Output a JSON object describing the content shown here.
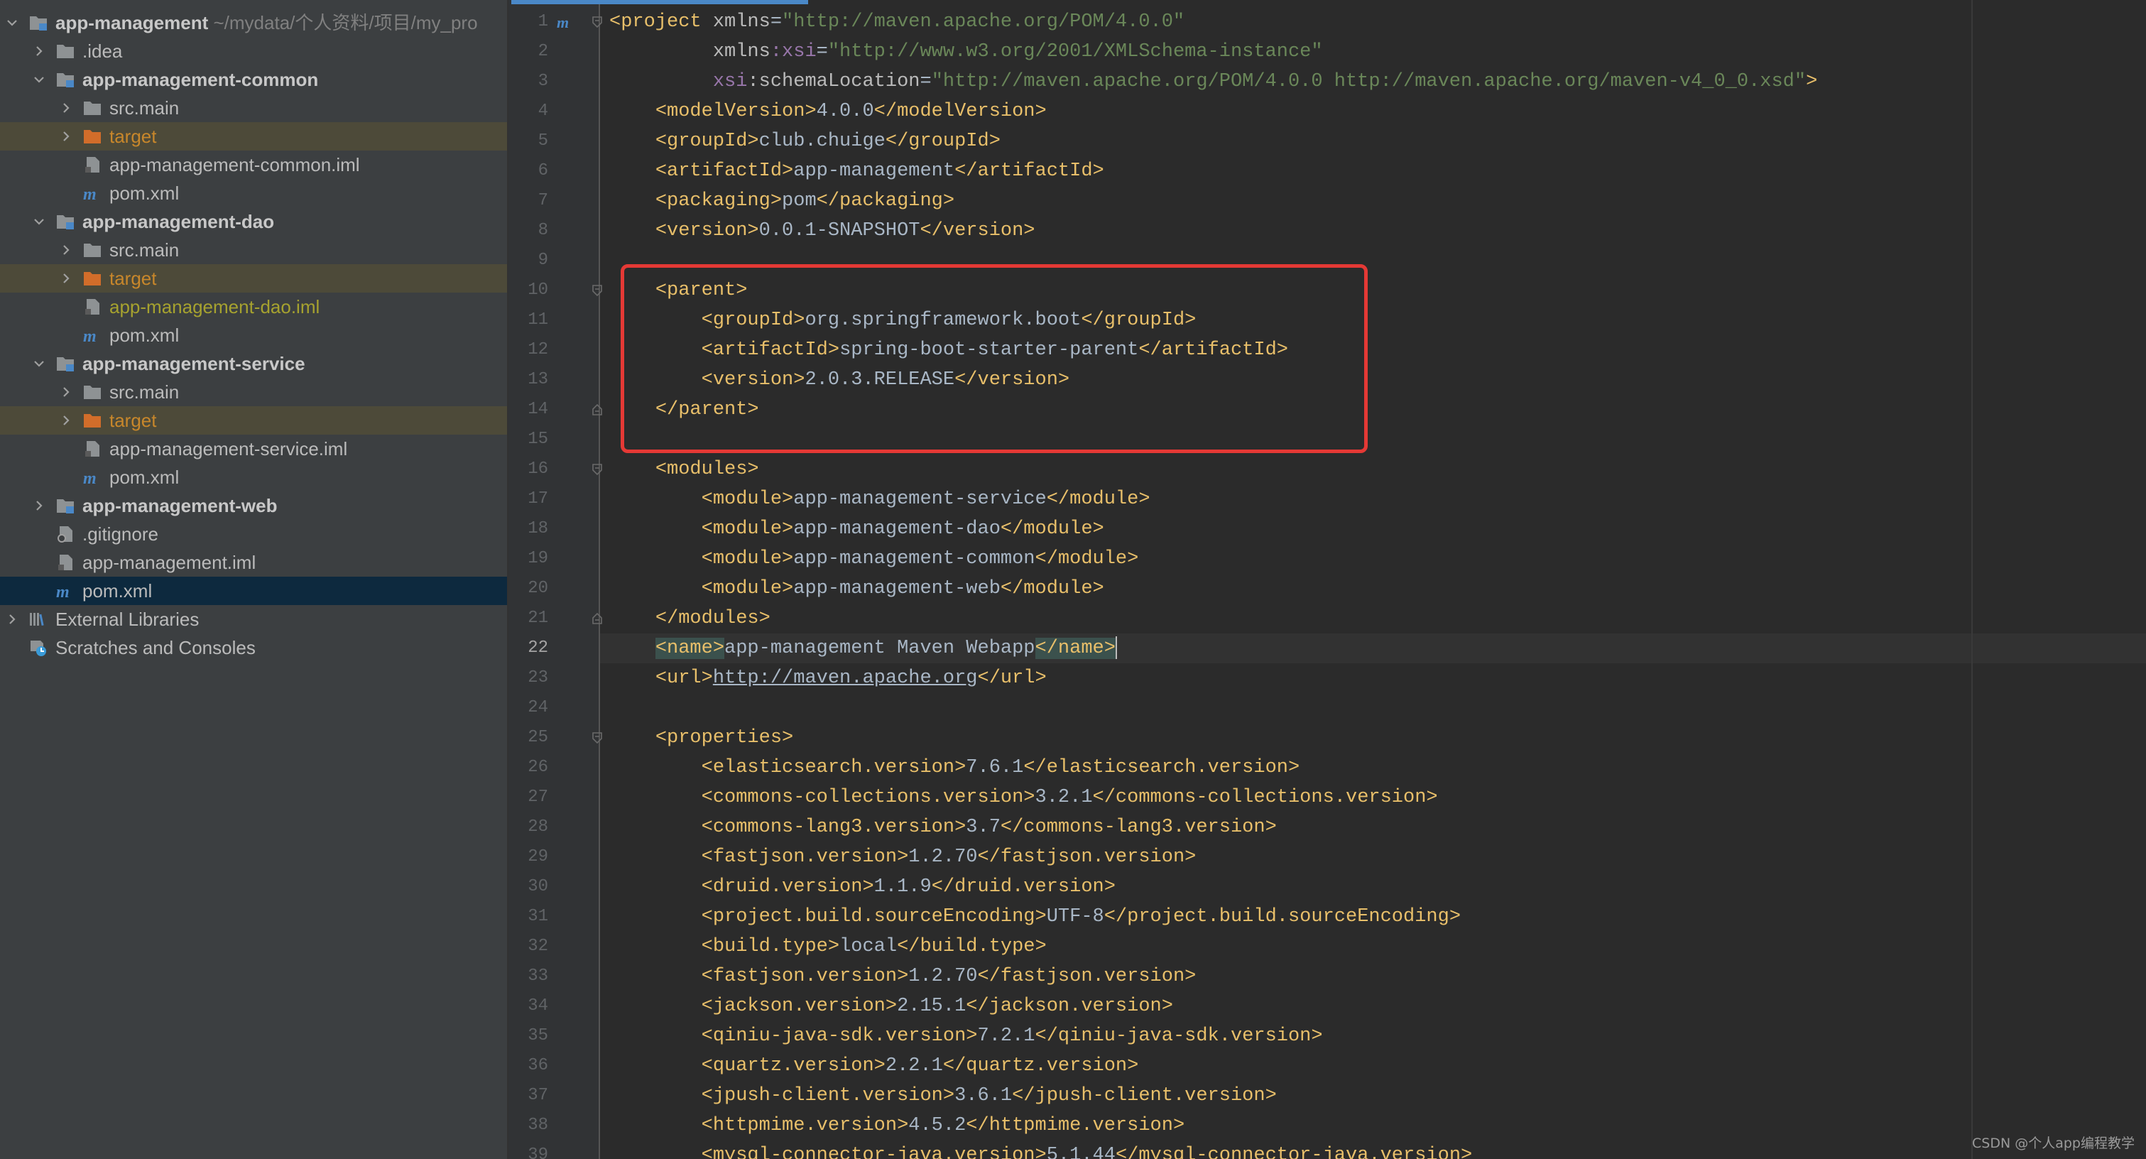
{
  "project_tree": {
    "items": [
      {
        "label": "app-management",
        "path": "~/mydata/个人资料/项目/my_pro",
        "kind": "module",
        "depth": 0,
        "state": "expanded",
        "bold": true
      },
      {
        "label": ".idea",
        "kind": "folder",
        "depth": 1,
        "state": "collapsed"
      },
      {
        "label": "app-management-common",
        "kind": "module",
        "depth": 1,
        "state": "expanded",
        "bold": true
      },
      {
        "label": "src.main",
        "kind": "folder",
        "depth": 2,
        "state": "collapsed"
      },
      {
        "label": "target",
        "kind": "excluded-folder",
        "depth": 2,
        "state": "collapsed",
        "status": "excluded"
      },
      {
        "label": "app-management-common.iml",
        "kind": "iml",
        "depth": 2
      },
      {
        "label": "pom.xml",
        "kind": "maven",
        "depth": 2
      },
      {
        "label": "app-management-dao",
        "kind": "module",
        "depth": 1,
        "state": "expanded",
        "bold": true
      },
      {
        "label": "src.main",
        "kind": "folder",
        "depth": 2,
        "state": "collapsed"
      },
      {
        "label": "target",
        "kind": "excluded-folder",
        "depth": 2,
        "state": "collapsed",
        "status": "excluded"
      },
      {
        "label": "app-management-dao.iml",
        "kind": "iml",
        "depth": 2,
        "status": "changed"
      },
      {
        "label": "pom.xml",
        "kind": "maven",
        "depth": 2
      },
      {
        "label": "app-management-service",
        "kind": "module",
        "depth": 1,
        "state": "expanded",
        "bold": true
      },
      {
        "label": "src.main",
        "kind": "folder",
        "depth": 2,
        "state": "collapsed"
      },
      {
        "label": "target",
        "kind": "excluded-folder",
        "depth": 2,
        "state": "collapsed",
        "status": "excluded"
      },
      {
        "label": "app-management-service.iml",
        "kind": "iml",
        "depth": 2
      },
      {
        "label": "pom.xml",
        "kind": "maven",
        "depth": 2
      },
      {
        "label": "app-management-web",
        "kind": "module",
        "depth": 1,
        "state": "collapsed",
        "bold": true
      },
      {
        "label": ".gitignore",
        "kind": "gitignore",
        "depth": 1
      },
      {
        "label": "app-management.iml",
        "kind": "iml",
        "depth": 1
      },
      {
        "label": "pom.xml",
        "kind": "maven",
        "depth": 1,
        "selected": true
      },
      {
        "label": "External Libraries",
        "kind": "libraries",
        "depth": 0,
        "state": "collapsed"
      },
      {
        "label": "Scratches and Consoles",
        "kind": "scratches",
        "depth": 0
      }
    ]
  },
  "editor": {
    "current_line": 22,
    "maven_marker": "m",
    "lines": [
      {
        "n": "1",
        "fold": "open",
        "tokens": [
          [
            "t",
            "<project "
          ],
          [
            "a",
            "xmlns"
          ],
          [
            "v",
            "="
          ],
          [
            "s",
            "\"http://maven.apache.org/POM/4.0.0\""
          ]
        ]
      },
      {
        "n": "2",
        "tokens": [
          [
            "v",
            "         "
          ],
          [
            "a",
            "xmlns"
          ],
          [
            "ns",
            ":xsi"
          ],
          [
            "v",
            "="
          ],
          [
            "s",
            "\"http://www.w3.org/2001/XMLSchema-instance\""
          ]
        ]
      },
      {
        "n": "3",
        "tokens": [
          [
            "v",
            "         "
          ],
          [
            "ns",
            "xsi"
          ],
          [
            "a",
            ":schemaLocation"
          ],
          [
            "v",
            "="
          ],
          [
            "s",
            "\"http://maven.apache.org/POM/4.0.0 http://maven.apache.org/maven-v4_0_0.xsd\""
          ],
          [
            "t",
            ">"
          ]
        ]
      },
      {
        "n": "4",
        "tokens": [
          [
            "v",
            "    "
          ],
          [
            "t",
            "<modelVersion>"
          ],
          [
            "v",
            "4.0.0"
          ],
          [
            "t",
            "</modelVersion>"
          ]
        ]
      },
      {
        "n": "5",
        "tokens": [
          [
            "v",
            "    "
          ],
          [
            "t",
            "<groupId>"
          ],
          [
            "v",
            "club.chuige"
          ],
          [
            "t",
            "</groupId>"
          ]
        ]
      },
      {
        "n": "6",
        "tokens": [
          [
            "v",
            "    "
          ],
          [
            "t",
            "<artifactId>"
          ],
          [
            "v",
            "app-management"
          ],
          [
            "t",
            "</artifactId>"
          ]
        ]
      },
      {
        "n": "7",
        "tokens": [
          [
            "v",
            "    "
          ],
          [
            "t",
            "<packaging>"
          ],
          [
            "v",
            "pom"
          ],
          [
            "t",
            "</packaging>"
          ]
        ]
      },
      {
        "n": "8",
        "tokens": [
          [
            "v",
            "    "
          ],
          [
            "t",
            "<version>"
          ],
          [
            "v",
            "0.0.1-SNAPSHOT"
          ],
          [
            "t",
            "</version>"
          ]
        ]
      },
      {
        "n": "9",
        "tokens": []
      },
      {
        "n": "10",
        "fold": "open",
        "tokens": [
          [
            "v",
            "    "
          ],
          [
            "t",
            "<parent>"
          ]
        ]
      },
      {
        "n": "11",
        "tokens": [
          [
            "v",
            "        "
          ],
          [
            "t",
            "<groupId>"
          ],
          [
            "v",
            "org.springframework.boot"
          ],
          [
            "t",
            "</groupId>"
          ]
        ]
      },
      {
        "n": "12",
        "tokens": [
          [
            "v",
            "        "
          ],
          [
            "t",
            "<artifactId>"
          ],
          [
            "v",
            "spring-boot-starter-parent"
          ],
          [
            "t",
            "</artifactId>"
          ]
        ]
      },
      {
        "n": "13",
        "tokens": [
          [
            "v",
            "        "
          ],
          [
            "t",
            "<version>"
          ],
          [
            "v",
            "2.0.3.RELEASE"
          ],
          [
            "t",
            "</version>"
          ]
        ]
      },
      {
        "n": "14",
        "fold": "close",
        "tokens": [
          [
            "v",
            "    "
          ],
          [
            "t",
            "</parent>"
          ]
        ]
      },
      {
        "n": "15",
        "tokens": []
      },
      {
        "n": "16",
        "fold": "open",
        "tokens": [
          [
            "v",
            "    "
          ],
          [
            "t",
            "<modules>"
          ]
        ]
      },
      {
        "n": "17",
        "tokens": [
          [
            "v",
            "        "
          ],
          [
            "t",
            "<module>"
          ],
          [
            "v",
            "app-management-service"
          ],
          [
            "t",
            "</module>"
          ]
        ]
      },
      {
        "n": "18",
        "tokens": [
          [
            "v",
            "        "
          ],
          [
            "t",
            "<module>"
          ],
          [
            "v",
            "app-management-dao"
          ],
          [
            "t",
            "</module>"
          ]
        ]
      },
      {
        "n": "19",
        "tokens": [
          [
            "v",
            "        "
          ],
          [
            "t",
            "<module>"
          ],
          [
            "v",
            "app-management-common"
          ],
          [
            "t",
            "</module>"
          ]
        ]
      },
      {
        "n": "20",
        "tokens": [
          [
            "v",
            "        "
          ],
          [
            "t",
            "<module>"
          ],
          [
            "v",
            "app-management-web"
          ],
          [
            "t",
            "</module>"
          ]
        ]
      },
      {
        "n": "21",
        "fold": "close",
        "tokens": [
          [
            "v",
            "    "
          ],
          [
            "t",
            "</modules>"
          ]
        ]
      },
      {
        "n": "22",
        "tokens": [
          [
            "v",
            "    "
          ],
          [
            "t mt",
            "<name>"
          ],
          [
            "v",
            "app-management Maven Webapp"
          ],
          [
            "t mt",
            "</name>"
          ]
        ],
        "caret": true
      },
      {
        "n": "23",
        "tokens": [
          [
            "v",
            "    "
          ],
          [
            "t",
            "<url>"
          ],
          [
            "u",
            "http://maven.apache.org"
          ],
          [
            "t",
            "</url>"
          ]
        ]
      },
      {
        "n": "24",
        "tokens": []
      },
      {
        "n": "25",
        "fold": "open",
        "tokens": [
          [
            "v",
            "    "
          ],
          [
            "t",
            "<properties>"
          ]
        ]
      },
      {
        "n": "26",
        "tokens": [
          [
            "v",
            "        "
          ],
          [
            "t",
            "<elasticsearch.version>"
          ],
          [
            "v",
            "7.6.1"
          ],
          [
            "t",
            "</elasticsearch.version>"
          ]
        ]
      },
      {
        "n": "27",
        "tokens": [
          [
            "v",
            "        "
          ],
          [
            "t",
            "<commons-collections.version>"
          ],
          [
            "v",
            "3.2.1"
          ],
          [
            "t",
            "</commons-collections.version>"
          ]
        ]
      },
      {
        "n": "28",
        "tokens": [
          [
            "v",
            "        "
          ],
          [
            "t",
            "<commons-lang3.version>"
          ],
          [
            "v",
            "3.7"
          ],
          [
            "t",
            "</commons-lang3.version>"
          ]
        ]
      },
      {
        "n": "29",
        "tokens": [
          [
            "v",
            "        "
          ],
          [
            "t",
            "<fastjson.version>"
          ],
          [
            "v",
            "1.2.70"
          ],
          [
            "t",
            "</fastjson.version>"
          ]
        ]
      },
      {
        "n": "30",
        "tokens": [
          [
            "v",
            "        "
          ],
          [
            "t",
            "<druid.version>"
          ],
          [
            "v",
            "1.1.9"
          ],
          [
            "t",
            "</druid.version>"
          ]
        ]
      },
      {
        "n": "31",
        "tokens": [
          [
            "v",
            "        "
          ],
          [
            "t",
            "<project.build.sourceEncoding>"
          ],
          [
            "v",
            "UTF-8"
          ],
          [
            "t",
            "</project.build.sourceEncoding>"
          ]
        ]
      },
      {
        "n": "32",
        "tokens": [
          [
            "v",
            "        "
          ],
          [
            "t",
            "<build.type>"
          ],
          [
            "v",
            "local"
          ],
          [
            "t",
            "</build.type>"
          ]
        ]
      },
      {
        "n": "33",
        "tokens": [
          [
            "v",
            "        "
          ],
          [
            "t",
            "<fastjson.version>"
          ],
          [
            "v",
            "1.2.70"
          ],
          [
            "t",
            "</fastjson.version>"
          ]
        ]
      },
      {
        "n": "34",
        "tokens": [
          [
            "v",
            "        "
          ],
          [
            "t",
            "<jackson.version>"
          ],
          [
            "v",
            "2.15.1"
          ],
          [
            "t",
            "</jackson.version>"
          ]
        ]
      },
      {
        "n": "35",
        "tokens": [
          [
            "v",
            "        "
          ],
          [
            "t",
            "<qiniu-java-sdk.version>"
          ],
          [
            "v",
            "7.2.1"
          ],
          [
            "t",
            "</qiniu-java-sdk.version>"
          ]
        ]
      },
      {
        "n": "36",
        "tokens": [
          [
            "v",
            "        "
          ],
          [
            "t",
            "<quartz.version>"
          ],
          [
            "v",
            "2.2.1"
          ],
          [
            "t",
            "</quartz.version>"
          ]
        ]
      },
      {
        "n": "37",
        "tokens": [
          [
            "v",
            "        "
          ],
          [
            "t",
            "<jpush-client.version>"
          ],
          [
            "v",
            "3.6.1"
          ],
          [
            "t",
            "</jpush-client.version>"
          ]
        ]
      },
      {
        "n": "38",
        "tokens": [
          [
            "v",
            "        "
          ],
          [
            "t",
            "<httpmime.version>"
          ],
          [
            "v",
            "4.5.2"
          ],
          [
            "t",
            "</httpmime.version>"
          ]
        ]
      },
      {
        "n": "39",
        "tokens": [
          [
            "v",
            "        "
          ],
          [
            "t",
            "<mysql-connector-java.version>"
          ],
          [
            "v",
            "5.1.44"
          ],
          [
            "t",
            "</mysql-connector-java.version>"
          ]
        ]
      }
    ]
  },
  "watermark": "CSDN @个人app编程教学",
  "colors": {
    "tag": "#e8bf6a",
    "value": "#a9b7c6",
    "string": "#6a8759",
    "namespace": "#9876aa",
    "highlight_box": "#e53935",
    "selection": "#0d293e",
    "excluded": "#c8872b"
  }
}
